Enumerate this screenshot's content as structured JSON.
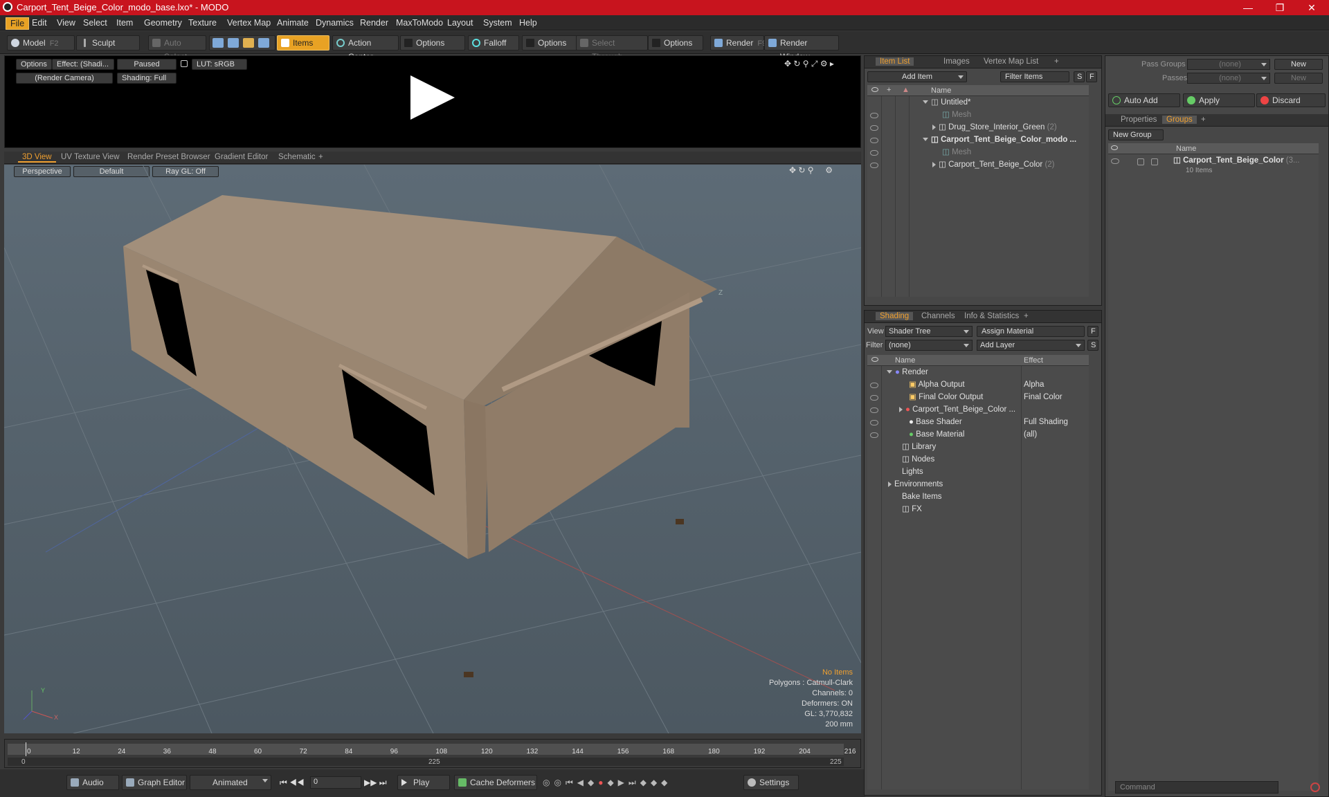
{
  "window": {
    "title": "Carport_Tent_Beige_Color_modo_base.lxo* - MODO"
  },
  "menu": [
    "File",
    "Edit",
    "View",
    "Select",
    "Item",
    "Geometry",
    "Texture",
    "Vertex Map",
    "Animate",
    "Dynamics",
    "Render",
    "MaxToModo",
    "Layout",
    "System",
    "Help"
  ],
  "toolbar": {
    "model": "Model",
    "model_key": "F2",
    "sculpt": "Sculpt",
    "auto_select": "Auto Select",
    "items": "Items",
    "action_center": "Action Center",
    "options1": "Options",
    "falloff": "Falloff",
    "options2": "Options",
    "select_through": "Select Through",
    "options3": "Options",
    "render": "Render",
    "render_key": "F9",
    "render_window": "Render Window"
  },
  "preview": {
    "options": "Options",
    "effect": "Effect: (Shadi...",
    "paused": "Paused",
    "lut": "LUT: sRGB",
    "camera": "(Render Camera)",
    "shading": "Shading: Full"
  },
  "viewport": {
    "tabs": [
      "3D View",
      "UV Texture View",
      "Render Preset Browser",
      "Gradient Editor",
      "Schematic"
    ],
    "perspective": "Perspective",
    "default": "Default",
    "raygl": "Ray GL: Off",
    "axis_z": "Z",
    "axis_y": "Y",
    "axis_x": "X",
    "stats": {
      "no_items": "No Items",
      "polygons": "Polygons : Catmull-Clark",
      "channels": "Channels: 0",
      "deformers": "Deformers: ON",
      "gl": "GL: 3,770,832",
      "size": "200 mm"
    }
  },
  "item_list": {
    "tabs": [
      "Item List",
      "Images",
      "Vertex Map List"
    ],
    "add_item": "Add Item",
    "filter": "Filter Items",
    "s": "S",
    "f": "F",
    "col_name": "Name",
    "rows": [
      {
        "label": "Untitled*",
        "indent": 0
      },
      {
        "label": "Mesh",
        "indent": 1
      },
      {
        "label": "Drug_Store_Interior_Green",
        "count": "(2)",
        "indent": 1
      },
      {
        "label": "Carport_Tent_Beige_Color_modo ...",
        "indent": 0
      },
      {
        "label": "Mesh",
        "indent": 1
      },
      {
        "label": "Carport_Tent_Beige_Color",
        "count": "(2)",
        "indent": 1
      }
    ]
  },
  "shading": {
    "tabs": [
      "Shading",
      "Channels",
      "Info & Statistics"
    ],
    "view_label": "View",
    "view_value": "Shader Tree",
    "assign": "Assign Material",
    "f": "F",
    "filter_label": "Filter",
    "filter_value": "(none)",
    "add_layer": "Add Layer",
    "s": "S",
    "col_name": "Name",
    "col_effect": "Effect",
    "rows": [
      {
        "label": "Render",
        "effect": ""
      },
      {
        "label": "Alpha Output",
        "effect": "Alpha"
      },
      {
        "label": "Final Color Output",
        "effect": "Final Color"
      },
      {
        "label": "Carport_Tent_Beige_Color ...",
        "effect": ""
      },
      {
        "label": "Base Shader",
        "effect": "Full Shading"
      },
      {
        "label": "Base Material",
        "effect": "(all)"
      },
      {
        "label": "Library",
        "effect": ""
      },
      {
        "label": "Nodes",
        "effect": ""
      },
      {
        "label": "Lights",
        "effect": ""
      },
      {
        "label": "Environments",
        "effect": ""
      },
      {
        "label": "Bake Items",
        "effect": ""
      },
      {
        "label": "FX",
        "effect": ""
      }
    ]
  },
  "groups": {
    "pass_groups": "Pass Groups",
    "passes": "Passes",
    "none1": "(none)",
    "none2": "(none)",
    "new1": "New",
    "new2": "New",
    "auto_add": "Auto Add",
    "apply": "Apply",
    "discard": "Discard",
    "tabs": [
      "Properties",
      "Groups"
    ],
    "new_group": "New Group",
    "col_name": "Name",
    "group_name": "Carport_Tent_Beige_Color",
    "group_suffix": "(3...",
    "group_items": "10 Items"
  },
  "timeline": {
    "ticks": [
      "0",
      "12",
      "24",
      "36",
      "48",
      "60",
      "72",
      "84",
      "96",
      "108",
      "120",
      "132",
      "144",
      "156",
      "168",
      "180",
      "192",
      "204",
      "216"
    ],
    "lower_left": "0",
    "lower_mid": "225",
    "lower_right": "225"
  },
  "bottom": {
    "audio": "Audio",
    "graph": "Graph Editor",
    "animated": "Animated",
    "frame": "0",
    "play": "Play",
    "cache": "Cache Deformers",
    "settings": "Settings",
    "command": "Command"
  },
  "colors": {
    "accent": "#e8a224",
    "title_red": "#c8141e",
    "tent": "#a28d78"
  }
}
